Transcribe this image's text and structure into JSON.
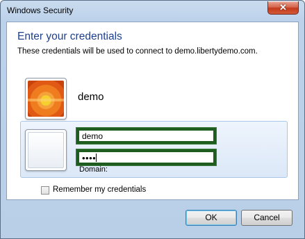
{
  "window": {
    "title": "Windows Security",
    "close_glyph": "✕"
  },
  "dialog": {
    "heading": "Enter your credentials",
    "subtitle": "These credentials will be used to connect to demo.libertydemo.com."
  },
  "existing_user": {
    "name": "demo"
  },
  "credentials": {
    "username_value": "demo",
    "password_masked": "••••",
    "domain_label": "Domain:"
  },
  "remember": {
    "label": "Remember my credentials",
    "checked": false
  },
  "buttons": {
    "ok": "OK",
    "cancel": "Cancel"
  },
  "colors": {
    "heading": "#1e3f8f",
    "highlight_border": "#1f5c1f",
    "close_button": "#c23a1c"
  },
  "icons": {
    "user_tile_1": "flower-picture-icon",
    "user_tile_2": "blank-user-tile-icon",
    "close": "close-icon"
  }
}
